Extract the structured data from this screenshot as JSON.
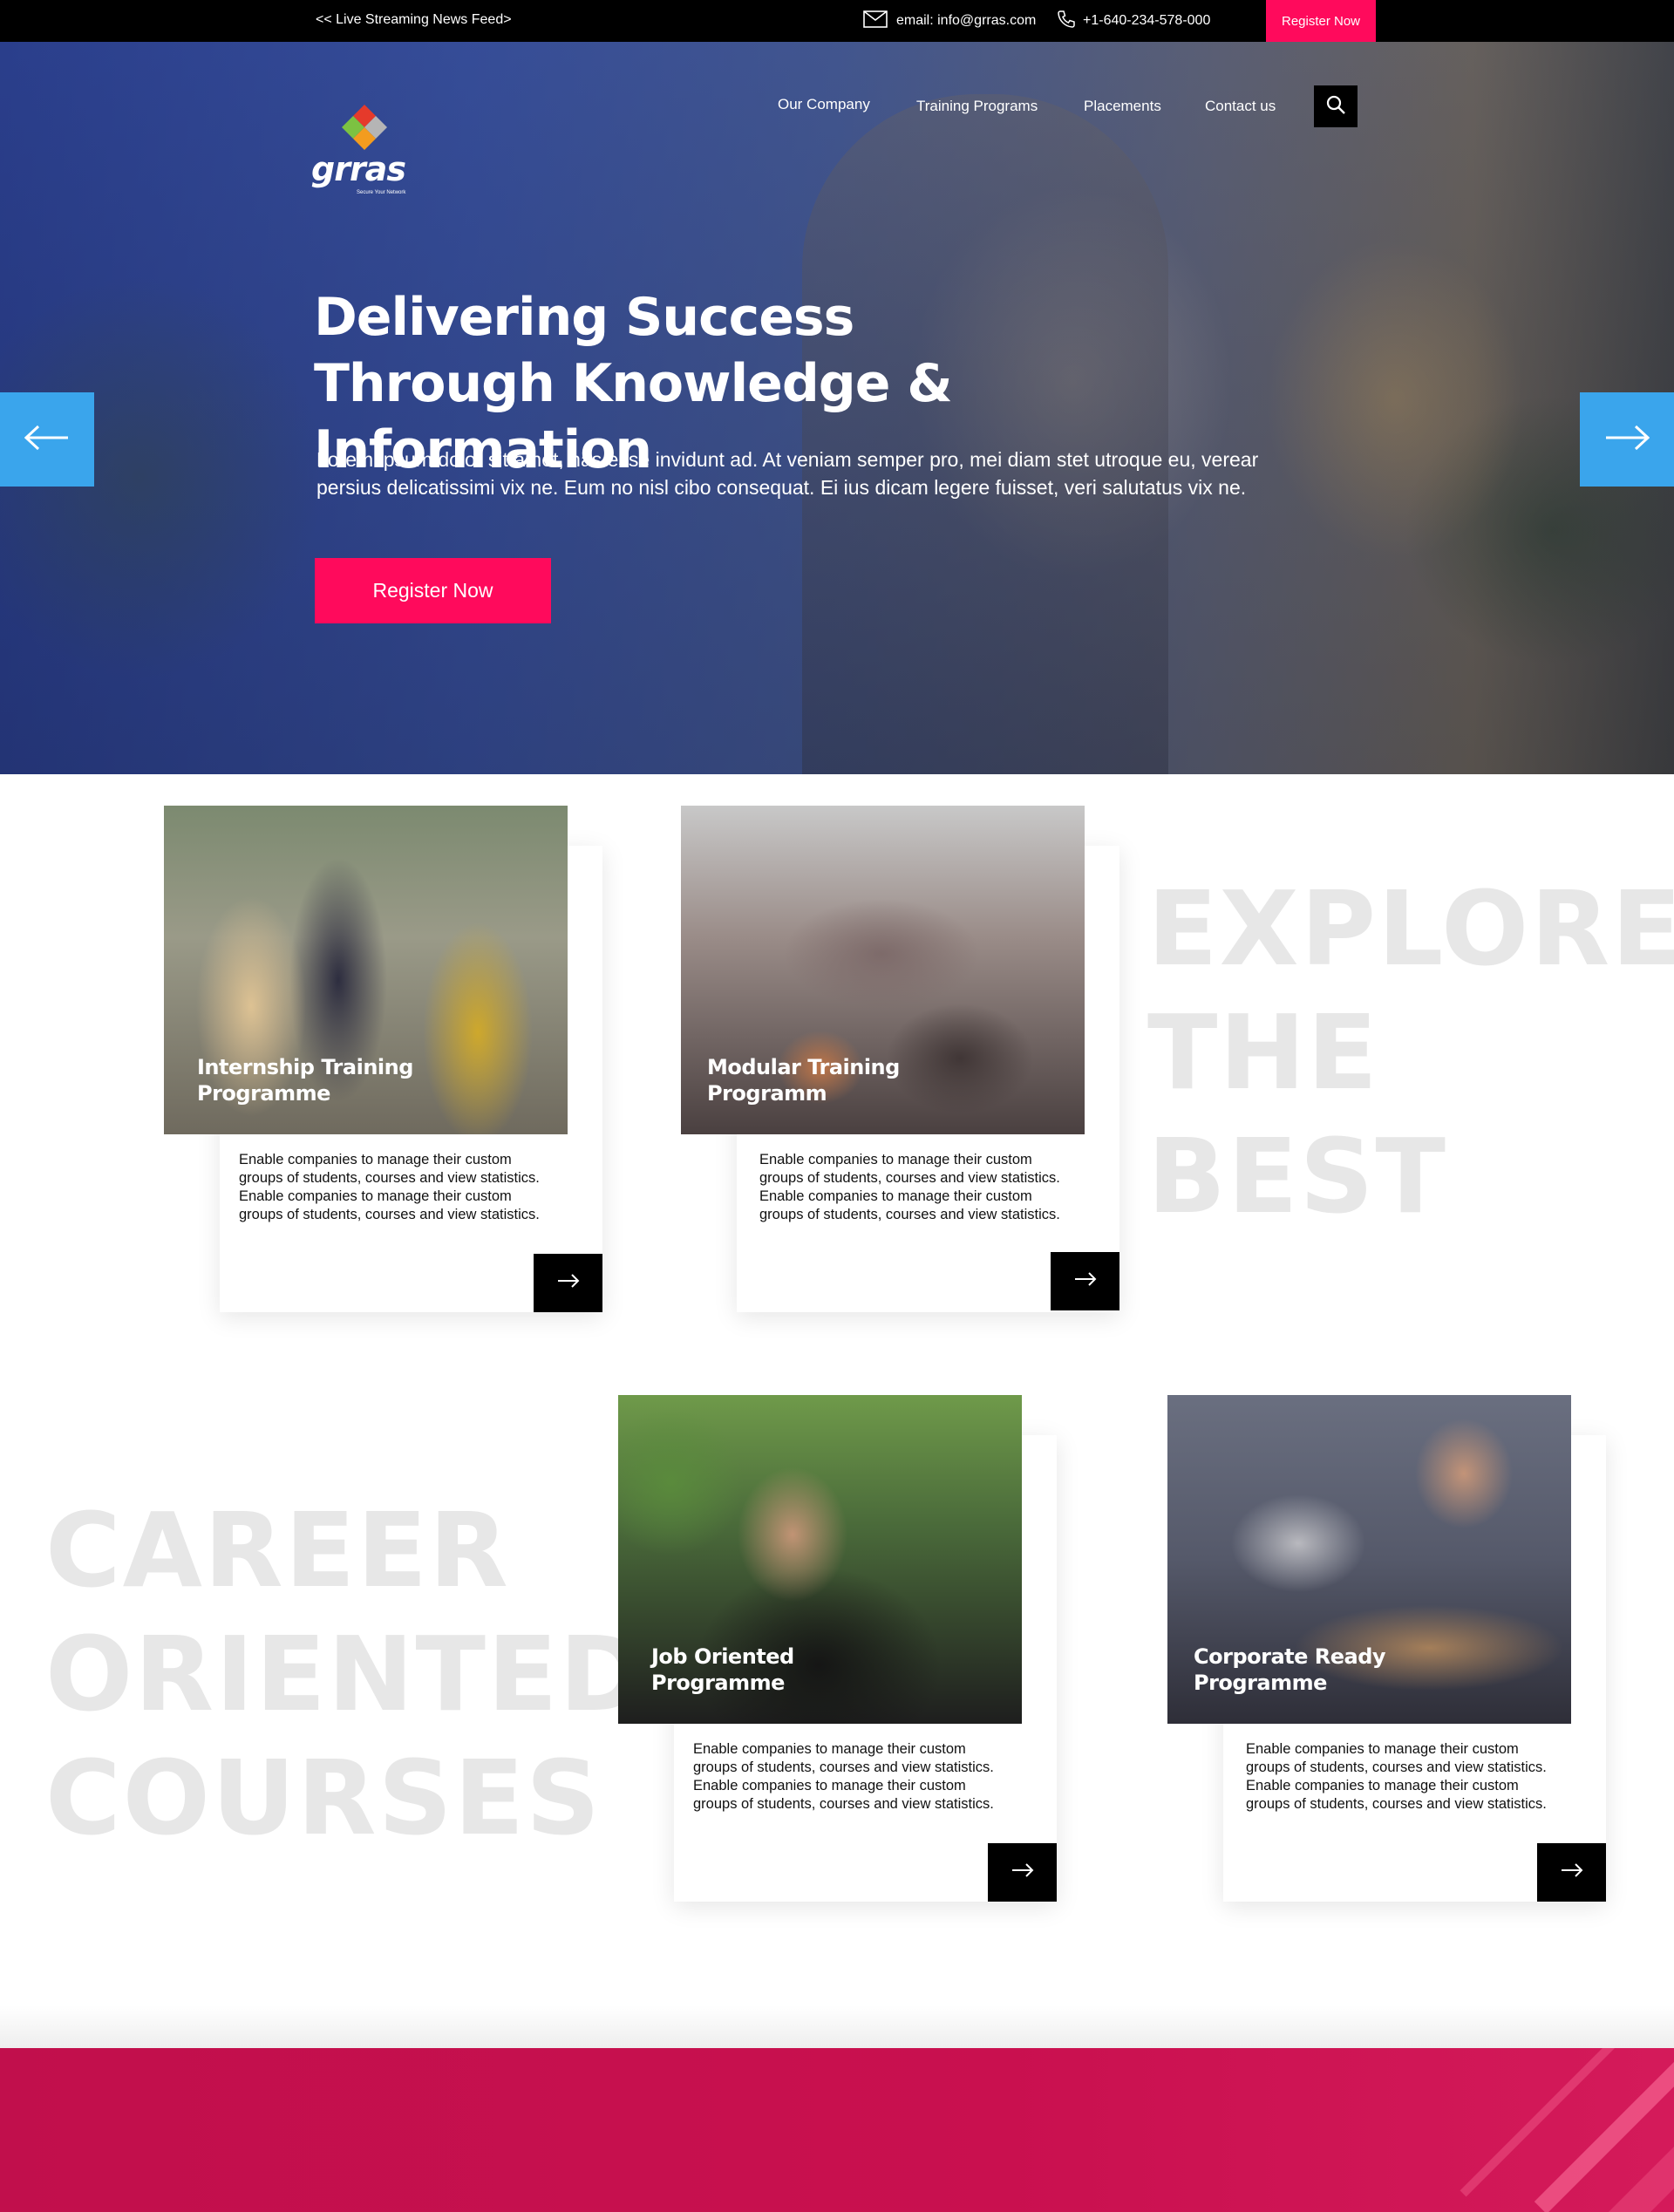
{
  "topbar": {
    "feed": "<< Live Streaming News Feed>",
    "email": "email: info@grras.com",
    "phone": "+1-640-234-578-000",
    "register": "Register Now"
  },
  "logo": {
    "word": "grras",
    "tagline": "Secure Your Network"
  },
  "nav": [
    "Our Company",
    "Training Programs",
    "Placements",
    "Contact us"
  ],
  "hero": {
    "title_line1": "Delivering Success",
    "title_line2": "Through Knowledge & Information",
    "text_line1": "Lorem ipsum dolor sit amet, has esse invidunt ad. At veniam semper pro, mei diam stet utroque eu, verear",
    "text_line2": "persius delicatissimi vix ne. Eum no nisl cibo consequat. Ei ius dicam legere fuisset, veri salutatus vix ne.",
    "button": "Register Now"
  },
  "sections": {
    "explore": [
      "EXPLORE",
      "THE",
      "BEST"
    ],
    "career": [
      "CAREER",
      "ORIENTED",
      "COURSES"
    ]
  },
  "courses": [
    {
      "title_line1": "Internship Training",
      "title_line2": "Programme",
      "desc": "Enable companies to manage their custom groups of students, courses and view statistics. Enable companies to manage their custom groups of students, courses and view statistics."
    },
    {
      "title_line1": "Modular Training",
      "title_line2": "Programm",
      "desc": "Enable companies to manage their custom groups of students, courses and view statistics. Enable companies to manage their custom groups of students, courses and view statistics."
    },
    {
      "title_line1": "Job Oriented",
      "title_line2": "Programme",
      "desc": "Enable companies to manage their custom groups of students, courses and view statistics. Enable companies to manage their custom groups of students, courses and view statistics."
    },
    {
      "title_line1": "Corporate Ready",
      "title_line2": "Programme",
      "desc": "Enable companies to manage their custom groups of students, courses and view statistics. Enable companies to manage their custom groups of students, courses and view statistics."
    }
  ],
  "colors": {
    "accent": "#ff0a5c",
    "slider_arrow": "#3aa5ec",
    "banner": "#c9104f",
    "ghost_text": "#e7e7e7"
  },
  "icons": [
    "envelope-icon",
    "phone-icon",
    "search-icon",
    "arrow-left-icon",
    "arrow-right-icon"
  ]
}
